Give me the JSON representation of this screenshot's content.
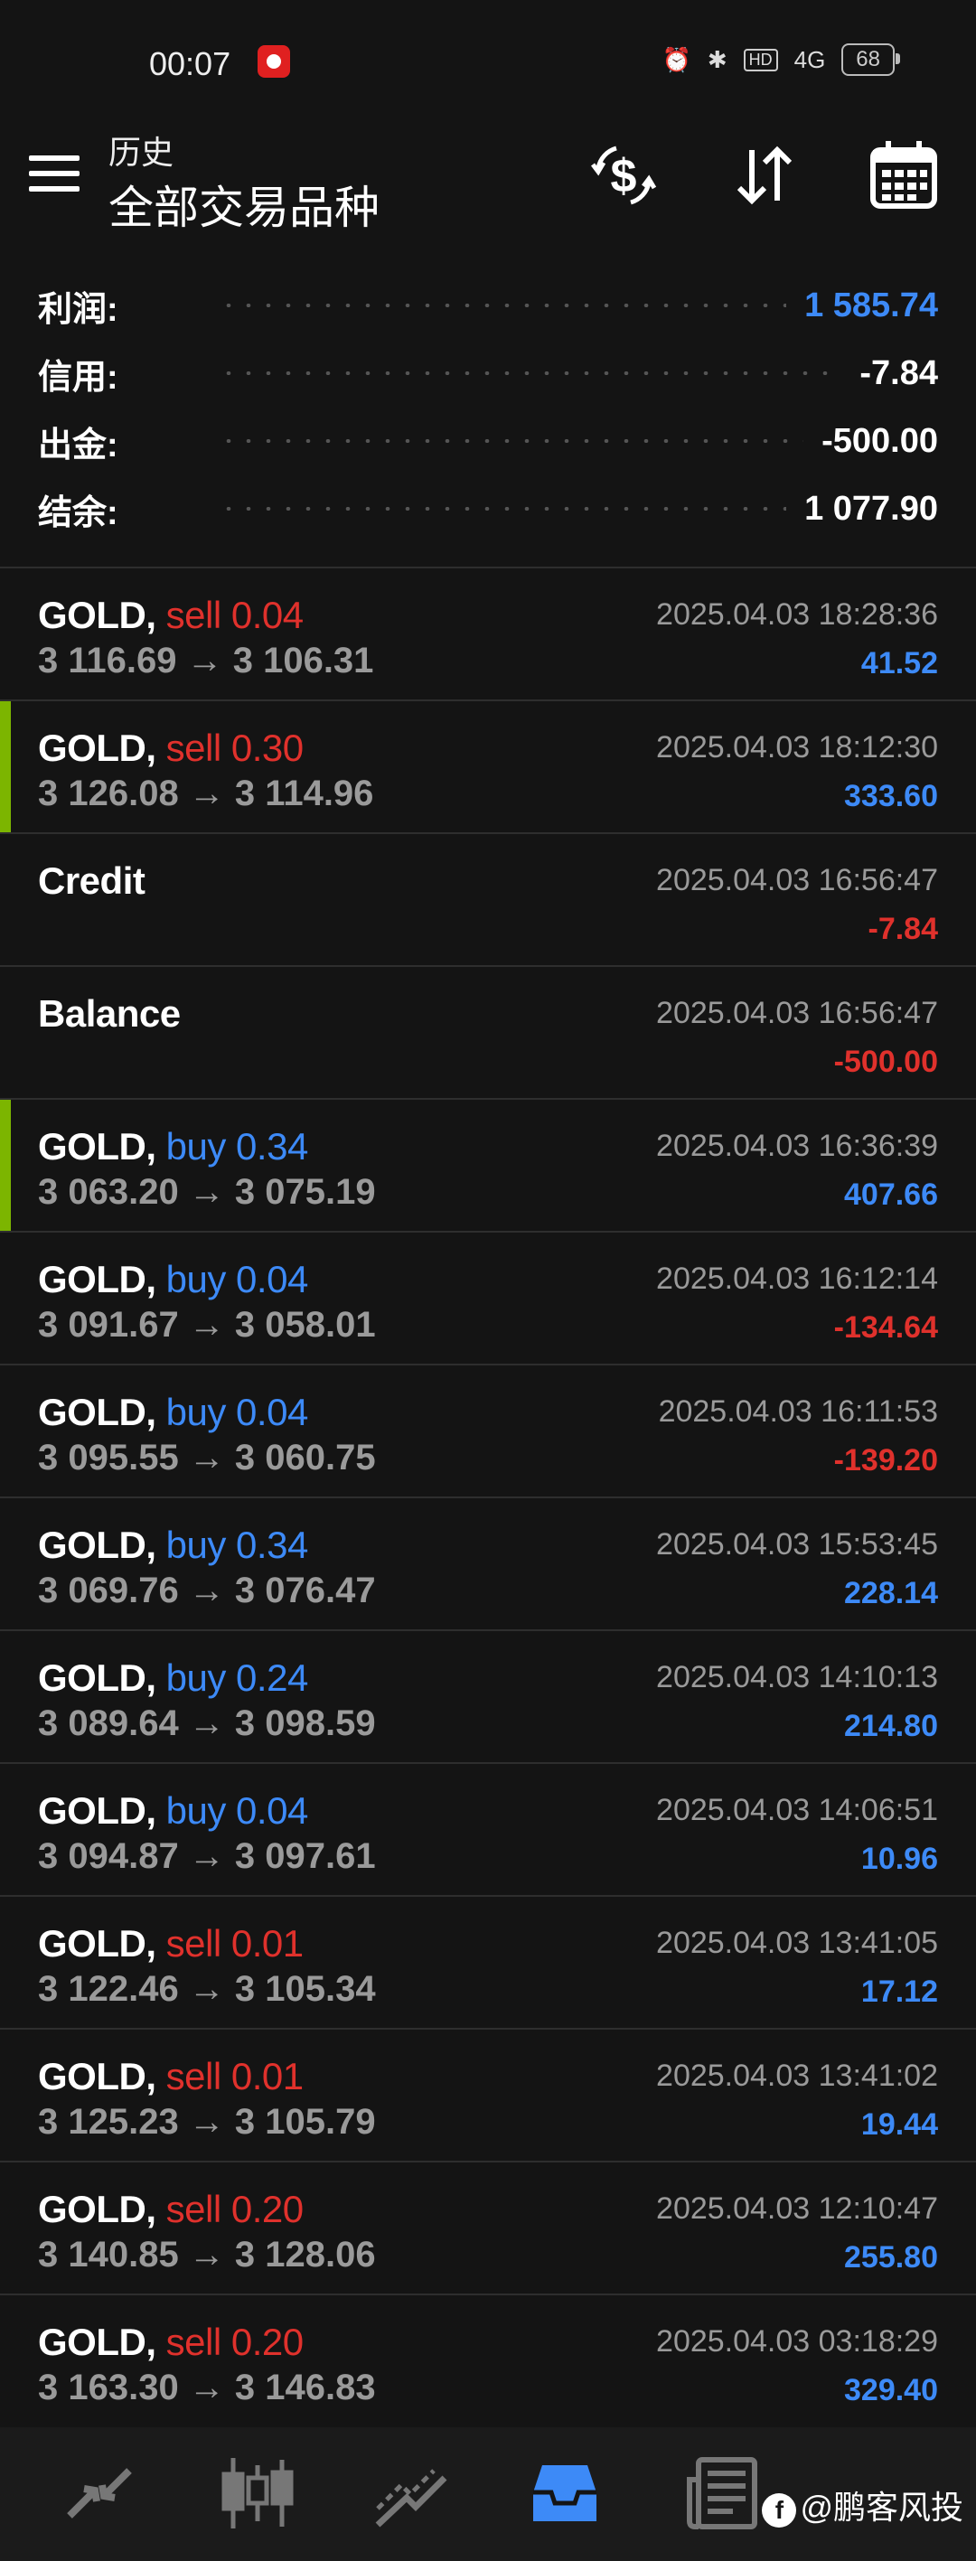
{
  "status": {
    "time": "00:07",
    "battery": "68",
    "network": "4G",
    "hd": "HD"
  },
  "appbar": {
    "subtitle": "历史",
    "title": "全部交易品种"
  },
  "summary": [
    {
      "label": "利润:",
      "value": "1 585.74",
      "highlight": true
    },
    {
      "label": "信用:",
      "value": "-7.84",
      "highlight": false
    },
    {
      "label": "出金:",
      "value": "-500.00",
      "highlight": false
    },
    {
      "label": "结余:",
      "value": "1 077.90",
      "highlight": false
    }
  ],
  "trades": [
    {
      "symbol": "GOLD,",
      "side": "sell 0.04",
      "dir": "sell",
      "prices": "3 116.69 → 3 106.31",
      "time": "2025.04.03 18:28:36",
      "pnl": "41.52",
      "sign": "pos",
      "accent": false
    },
    {
      "symbol": "GOLD,",
      "side": "sell 0.30",
      "dir": "sell",
      "prices": "3 126.08 → 3 114.96",
      "time": "2025.04.03 18:12:30",
      "pnl": "333.60",
      "sign": "pos",
      "accent": true
    },
    {
      "symbol": "Credit",
      "side": "",
      "dir": "",
      "prices": "",
      "time": "2025.04.03 16:56:47",
      "pnl": "-7.84",
      "sign": "neg",
      "accent": false
    },
    {
      "symbol": "Balance",
      "side": "",
      "dir": "",
      "prices": "",
      "time": "2025.04.03 16:56:47",
      "pnl": "-500.00",
      "sign": "neg",
      "accent": false
    },
    {
      "symbol": "GOLD,",
      "side": "buy 0.34",
      "dir": "buy",
      "prices": "3 063.20 → 3 075.19",
      "time": "2025.04.03 16:36:39",
      "pnl": "407.66",
      "sign": "pos",
      "accent": true
    },
    {
      "symbol": "GOLD,",
      "side": "buy 0.04",
      "dir": "buy",
      "prices": "3 091.67 → 3 058.01",
      "time": "2025.04.03 16:12:14",
      "pnl": "-134.64",
      "sign": "neg",
      "accent": false
    },
    {
      "symbol": "GOLD,",
      "side": "buy 0.04",
      "dir": "buy",
      "prices": "3 095.55 → 3 060.75",
      "time": "2025.04.03 16:11:53",
      "pnl": "-139.20",
      "sign": "neg",
      "accent": false
    },
    {
      "symbol": "GOLD,",
      "side": "buy 0.34",
      "dir": "buy",
      "prices": "3 069.76 → 3 076.47",
      "time": "2025.04.03 15:53:45",
      "pnl": "228.14",
      "sign": "pos",
      "accent": false
    },
    {
      "symbol": "GOLD,",
      "side": "buy 0.24",
      "dir": "buy",
      "prices": "3 089.64 → 3 098.59",
      "time": "2025.04.03 14:10:13",
      "pnl": "214.80",
      "sign": "pos",
      "accent": false
    },
    {
      "symbol": "GOLD,",
      "side": "buy 0.04",
      "dir": "buy",
      "prices": "3 094.87 → 3 097.61",
      "time": "2025.04.03 14:06:51",
      "pnl": "10.96",
      "sign": "pos",
      "accent": false
    },
    {
      "symbol": "GOLD,",
      "side": "sell 0.01",
      "dir": "sell",
      "prices": "3 122.46 → 3 105.34",
      "time": "2025.04.03 13:41:05",
      "pnl": "17.12",
      "sign": "pos",
      "accent": false
    },
    {
      "symbol": "GOLD,",
      "side": "sell 0.01",
      "dir": "sell",
      "prices": "3 125.23 → 3 105.79",
      "time": "2025.04.03 13:41:02",
      "pnl": "19.44",
      "sign": "pos",
      "accent": false
    },
    {
      "symbol": "GOLD,",
      "side": "sell 0.20",
      "dir": "sell",
      "prices": "3 140.85 → 3 128.06",
      "time": "2025.04.03 12:10:47",
      "pnl": "255.80",
      "sign": "pos",
      "accent": false
    },
    {
      "symbol": "GOLD,",
      "side": "sell 0.20",
      "dir": "sell",
      "prices": "3 163.30 → 3 146.83",
      "time": "2025.04.03 03:18:29",
      "pnl": "329.40",
      "sign": "pos",
      "accent": false
    }
  ],
  "icons": {
    "appbar": [
      "menu-icon",
      "currency-exchange-icon",
      "sort-icon",
      "calendar-icon"
    ],
    "nav": [
      "quotes-icon",
      "chart-icon",
      "trade-icon",
      "history-icon",
      "news-icon"
    ]
  },
  "watermark": {
    "text": "@鹏客风投",
    "logo": "f"
  },
  "colors": {
    "bg": "#141414",
    "blue": "#3d8af7",
    "red": "#e0312c",
    "accent": "#7cb500",
    "muted": "#9a9a9a"
  }
}
